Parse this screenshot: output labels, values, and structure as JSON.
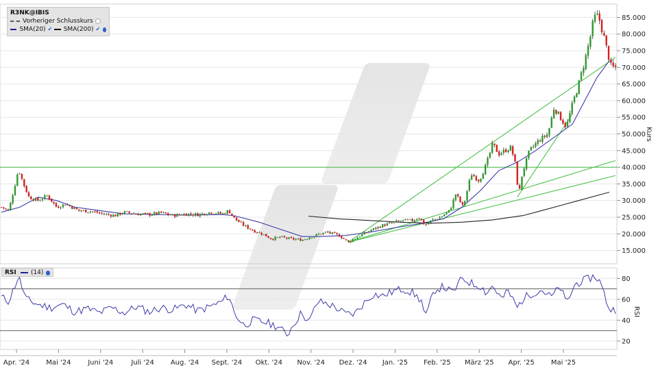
{
  "chart_data": [
    {
      "type": "candlestick",
      "legend": {
        "symbol": "R3NK@IBIS",
        "prev_close_label": "Vorheriger Schlusskurs",
        "sma20_label": "SMA(20)",
        "sma200_label": "SMA(200)"
      },
      "ylabel": "Kurs",
      "ylim": [
        11,
        89
      ],
      "y_ticks": [
        15,
        20,
        25,
        30,
        35,
        40,
        45,
        50,
        55,
        60,
        65,
        70,
        75,
        80,
        85
      ],
      "y_tick_labels": [
        "15.000",
        "20.000",
        "25.000",
        "30.000",
        "35.000",
        "40.000",
        "45.000",
        "50.000",
        "55.000",
        "60.000",
        "65.000",
        "70.000",
        "75.000",
        "80.000",
        "85.000"
      ],
      "x_months": [
        "Apr. '24",
        "Mai '24",
        "Juni '24",
        "Juli '24",
        "Aug. '24",
        "Sept. '24",
        "Okt. '24",
        "Nov. '24",
        "Dez. '24",
        "Jan. '25",
        "Feb. '25",
        "März '25",
        "Apr. '25",
        "Mai '25"
      ],
      "horizontal_lines": [
        40
      ],
      "trend_lines": [
        {
          "from": [
            0.565,
            17.5
          ],
          "to": [
            1.0,
            73
          ]
        },
        {
          "from": [
            0.565,
            17.5
          ],
          "to": [
            1.0,
            42
          ]
        },
        {
          "from": [
            0.565,
            17.5
          ],
          "to": [
            1.0,
            37.5
          ]
        },
        {
          "from": [
            0.84,
            31
          ],
          "to": [
            0.93,
            56
          ]
        }
      ],
      "price_path": [
        [
          0.0,
          28
        ],
        [
          0.012,
          27
        ],
        [
          0.02,
          33
        ],
        [
          0.028,
          39.5
        ],
        [
          0.036,
          35
        ],
        [
          0.045,
          31
        ],
        [
          0.06,
          30
        ],
        [
          0.075,
          31.5
        ],
        [
          0.09,
          28
        ],
        [
          0.105,
          29
        ],
        [
          0.125,
          27
        ],
        [
          0.145,
          26.8
        ],
        [
          0.165,
          26
        ],
        [
          0.185,
          25.5
        ],
        [
          0.2,
          26.5
        ],
        [
          0.22,
          26
        ],
        [
          0.24,
          25.8
        ],
        [
          0.26,
          26.3
        ],
        [
          0.28,
          25.5
        ],
        [
          0.3,
          26
        ],
        [
          0.32,
          25.8
        ],
        [
          0.34,
          26.5
        ],
        [
          0.36,
          26
        ],
        [
          0.37,
          27
        ],
        [
          0.38,
          24.5
        ],
        [
          0.395,
          22.5
        ],
        [
          0.41,
          21
        ],
        [
          0.425,
          20
        ],
        [
          0.44,
          18.5
        ],
        [
          0.455,
          19
        ],
        [
          0.47,
          18.5
        ],
        [
          0.49,
          18.2
        ],
        [
          0.51,
          19.5
        ],
        [
          0.53,
          20.5
        ],
        [
          0.55,
          19.5
        ],
        [
          0.565,
          17.5
        ],
        [
          0.58,
          19
        ],
        [
          0.6,
          21
        ],
        [
          0.62,
          22.5
        ],
        [
          0.64,
          23.5
        ],
        [
          0.655,
          24
        ],
        [
          0.67,
          24
        ],
        [
          0.68,
          25
        ],
        [
          0.69,
          22.5
        ],
        [
          0.7,
          24
        ],
        [
          0.715,
          25
        ],
        [
          0.73,
          27
        ],
        [
          0.74,
          32
        ],
        [
          0.752,
          28
        ],
        [
          0.765,
          38
        ],
        [
          0.778,
          36
        ],
        [
          0.79,
          41
        ],
        [
          0.8,
          47
        ],
        [
          0.81,
          44
        ],
        [
          0.82,
          45
        ],
        [
          0.83,
          46
        ],
        [
          0.838,
          40
        ],
        [
          0.842,
          31
        ],
        [
          0.848,
          38
        ],
        [
          0.86,
          45
        ],
        [
          0.875,
          48
        ],
        [
          0.89,
          50
        ],
        [
          0.9,
          58
        ],
        [
          0.91,
          55
        ],
        [
          0.92,
          52
        ],
        [
          0.93,
          59
        ],
        [
          0.94,
          65
        ],
        [
          0.95,
          72
        ],
        [
          0.96,
          80
        ],
        [
          0.965,
          85
        ],
        [
          0.972,
          85.5
        ],
        [
          0.98,
          80
        ],
        [
          0.985,
          76
        ],
        [
          0.993,
          70
        ]
      ],
      "sma20_path": [
        [
          0.0,
          26.5
        ],
        [
          0.03,
          28
        ],
        [
          0.06,
          31
        ],
        [
          0.09,
          30
        ],
        [
          0.12,
          28
        ],
        [
          0.16,
          27
        ],
        [
          0.2,
          26
        ],
        [
          0.25,
          25.8
        ],
        [
          0.3,
          25.6
        ],
        [
          0.36,
          25.8
        ],
        [
          0.38,
          25.4
        ],
        [
          0.42,
          23.5
        ],
        [
          0.46,
          21
        ],
        [
          0.49,
          19.2
        ],
        [
          0.52,
          19.2
        ],
        [
          0.56,
          19.5
        ],
        [
          0.6,
          20.5
        ],
        [
          0.64,
          21.8
        ],
        [
          0.68,
          23
        ],
        [
          0.72,
          24.5
        ],
        [
          0.75,
          28
        ],
        [
          0.78,
          33
        ],
        [
          0.81,
          39
        ],
        [
          0.84,
          41.5
        ],
        [
          0.87,
          45
        ],
        [
          0.9,
          49
        ],
        [
          0.93,
          53
        ],
        [
          0.95,
          60
        ],
        [
          0.97,
          67
        ],
        [
          0.99,
          72
        ]
      ],
      "sma200_path": [
        [
          0.5,
          25.3
        ],
        [
          0.55,
          24.5
        ],
        [
          0.6,
          24
        ],
        [
          0.65,
          23.5
        ],
        [
          0.7,
          23.2
        ],
        [
          0.75,
          23.5
        ],
        [
          0.8,
          24.2
        ],
        [
          0.85,
          25.5
        ],
        [
          0.88,
          27
        ],
        [
          0.91,
          28.5
        ],
        [
          0.94,
          30
        ],
        [
          0.97,
          31.5
        ],
        [
          0.99,
          32.5
        ]
      ]
    },
    {
      "type": "line",
      "legend": {
        "label": "RSI",
        "period": "(14)"
      },
      "ylabel": "RSI",
      "ylim": [
        12,
        90
      ],
      "y_ticks": [
        20,
        40,
        60,
        80
      ],
      "y_tick_labels": [
        "20",
        "40",
        "60",
        "80"
      ],
      "reference_lines": [
        30,
        70
      ],
      "rsi_path": [
        [
          0.0,
          62
        ],
        [
          0.012,
          58
        ],
        [
          0.028,
          82
        ],
        [
          0.04,
          60
        ],
        [
          0.06,
          55
        ],
        [
          0.08,
          52
        ],
        [
          0.1,
          55
        ],
        [
          0.12,
          48
        ],
        [
          0.14,
          51
        ],
        [
          0.16,
          47
        ],
        [
          0.18,
          52
        ],
        [
          0.2,
          47
        ],
        [
          0.22,
          53
        ],
        [
          0.24,
          48
        ],
        [
          0.26,
          52
        ],
        [
          0.28,
          50
        ],
        [
          0.3,
          55
        ],
        [
          0.32,
          49
        ],
        [
          0.34,
          53
        ],
        [
          0.36,
          58
        ],
        [
          0.37,
          64
        ],
        [
          0.38,
          46
        ],
        [
          0.395,
          35
        ],
        [
          0.41,
          40
        ],
        [
          0.43,
          38
        ],
        [
          0.45,
          34
        ],
        [
          0.465,
          26
        ],
        [
          0.48,
          40
        ],
        [
          0.49,
          48
        ],
        [
          0.5,
          37
        ],
        [
          0.515,
          58
        ],
        [
          0.53,
          56
        ],
        [
          0.545,
          52
        ],
        [
          0.56,
          46
        ],
        [
          0.575,
          46
        ],
        [
          0.59,
          56
        ],
        [
          0.605,
          65
        ],
        [
          0.62,
          63
        ],
        [
          0.64,
          68
        ],
        [
          0.655,
          70
        ],
        [
          0.67,
          66
        ],
        [
          0.685,
          58
        ],
        [
          0.69,
          41
        ],
        [
          0.705,
          69
        ],
        [
          0.72,
          72
        ],
        [
          0.735,
          66
        ],
        [
          0.75,
          80
        ],
        [
          0.77,
          74
        ],
        [
          0.78,
          73
        ],
        [
          0.79,
          66
        ],
        [
          0.8,
          73
        ],
        [
          0.815,
          60
        ],
        [
          0.825,
          68
        ],
        [
          0.84,
          52
        ],
        [
          0.85,
          61
        ],
        [
          0.865,
          66
        ],
        [
          0.88,
          69
        ],
        [
          0.895,
          62
        ],
        [
          0.91,
          72
        ],
        [
          0.92,
          56
        ],
        [
          0.935,
          75
        ],
        [
          0.95,
          78
        ],
        [
          0.965,
          82
        ],
        [
          0.973,
          79
        ],
        [
          0.98,
          68
        ],
        [
          0.99,
          50
        ]
      ]
    }
  ]
}
